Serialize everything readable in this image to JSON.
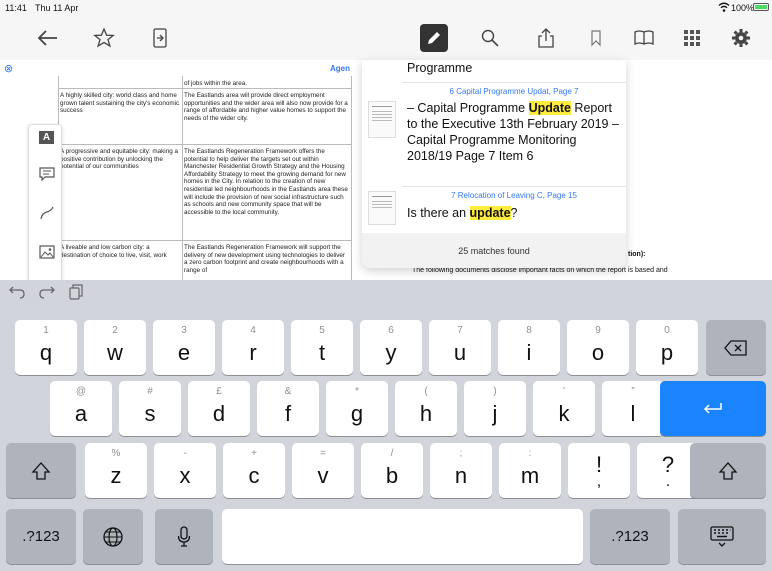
{
  "status": {
    "time": "11:41",
    "date": "Thu 11 Apr",
    "battery": "100%",
    "battery_color": "#4cd964"
  },
  "toolbar": {
    "icons": [
      "back-arrow-icon",
      "star-icon",
      "share-page-icon",
      "pen-icon",
      "search-icon",
      "export-icon",
      "bookmark-icon",
      "book-icon",
      "grid-icon",
      "gear-icon"
    ],
    "active_color": "#333333"
  },
  "document": {
    "close_label": "⊗",
    "header_text": "Agen",
    "col1": [
      "A highly skilled city: world class and home grown talent sustaining the city's economic success",
      "A progressive and equitable city: making a positive contribution by unlocking the potential of our communities",
      "A liveable and low carbon city: a destination of choice to live, visit, work"
    ],
    "col2": [
      "of jobs within the area.",
      "The Eastlands area will provide direct employment opportunities and the wider area will also now provide for a range of affordable and higher value homes to support the needs of the wider city.",
      "The Eastlands Regeneration Framework offers the potential to help deliver the targets set out within Manchester Residential Growth Strategy and the Housing Affordability Strategy to meet the growing demand for new homes in the City. In relation to the creation of new residential led neighbourhoods in the Eastlands area these will include the provision of new social infrastructure such as schools and new community space that will be accessible to the local community.",
      "The Eastlands Regeneration Framework will support the delivery of new development using technologies to deliver a zero carbon footprint and create neighbourhoods with a range of"
    ],
    "right_heading_fragment": "tion):",
    "right_body": "The following documents disclose important facts on which the report is based and"
  },
  "search_results": {
    "partial_top": "Programme",
    "items": [
      {
        "meta": "6 Capital Programme Updat, Page 7",
        "before": "– Capital Programme ",
        "match": "Update",
        "after": " Report to the Executive 13th February 2019 – Capital Programme Monitoring 2018/19 Page 7 Item 6"
      },
      {
        "meta": "7 Relocation of Leaving C, Page 15",
        "before": "Is there an ",
        "match": "update",
        "after": "?"
      }
    ],
    "count_text": "25 matches found"
  },
  "keyboard": {
    "row1": [
      {
        "main": "q",
        "sub": "1"
      },
      {
        "main": "w",
        "sub": "2"
      },
      {
        "main": "e",
        "sub": "3"
      },
      {
        "main": "r",
        "sub": "4"
      },
      {
        "main": "t",
        "sub": "5"
      },
      {
        "main": "y",
        "sub": "6"
      },
      {
        "main": "u",
        "sub": "7"
      },
      {
        "main": "i",
        "sub": "8"
      },
      {
        "main": "o",
        "sub": "9"
      },
      {
        "main": "p",
        "sub": "0"
      }
    ],
    "row2": [
      {
        "main": "a",
        "sub": "@"
      },
      {
        "main": "s",
        "sub": "#"
      },
      {
        "main": "d",
        "sub": "£"
      },
      {
        "main": "f",
        "sub": "&"
      },
      {
        "main": "g",
        "sub": "*"
      },
      {
        "main": "h",
        "sub": "("
      },
      {
        "main": "j",
        "sub": ")"
      },
      {
        "main": "k",
        "sub": "’"
      },
      {
        "main": "l",
        "sub": "”"
      }
    ],
    "row3": [
      {
        "main": "z",
        "sub": "%"
      },
      {
        "main": "x",
        "sub": "-"
      },
      {
        "main": "c",
        "sub": "+"
      },
      {
        "main": "v",
        "sub": "="
      },
      {
        "main": "b",
        "sub": "/"
      },
      {
        "main": "n",
        "sub": ";"
      },
      {
        "main": "m",
        "sub": ":"
      },
      {
        "main": "!",
        "sub": "",
        "small": ","
      },
      {
        "main": "?",
        "sub": "",
        "small": "."
      }
    ],
    "numbers_label": ".?123",
    "accent": "#1a84ff"
  }
}
